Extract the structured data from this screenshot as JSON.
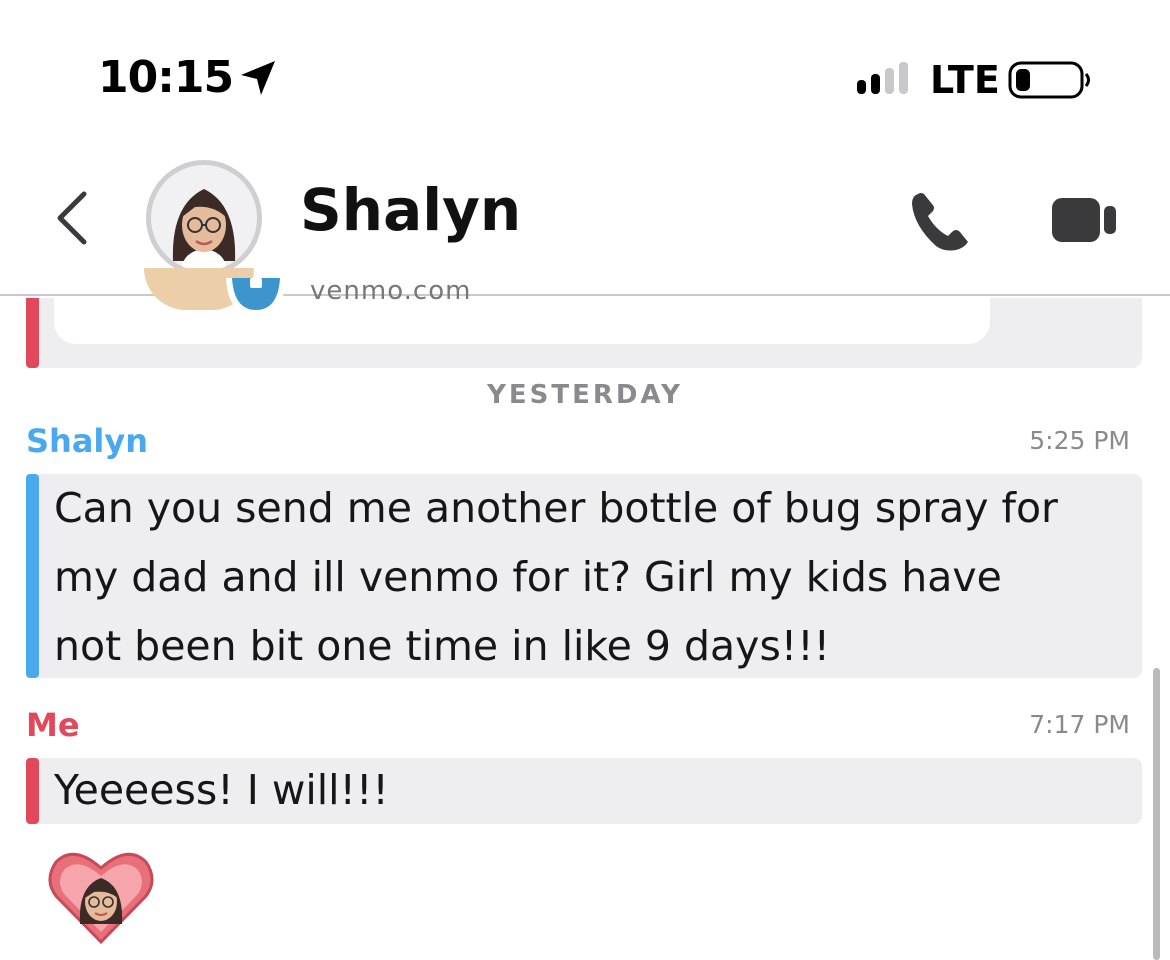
{
  "status_bar": {
    "time": "10:15",
    "network": "LTE",
    "icons": [
      "location-arrow-icon",
      "signal-icon",
      "battery-icon"
    ]
  },
  "header": {
    "contact_name": "Shalyn",
    "icons": [
      "chevron-left-icon",
      "avatar",
      "phone-icon",
      "video-camera-icon"
    ]
  },
  "previous_card": {
    "domain": "venmo.com"
  },
  "day_divider": "YESTERDAY",
  "messages": [
    {
      "sender": "Shalyn",
      "time": "5:25 PM",
      "lines": [
        "Can you send me another bottle of bug spray for",
        "my dad and ill venmo for it? Girl my kids have",
        "not been bit one time in like 9 days!!!"
      ]
    },
    {
      "sender": "Me",
      "time": "7:17 PM",
      "lines": [
        "Yeeeess! I will!!!"
      ]
    }
  ],
  "colors": {
    "them": "#4aa8ee",
    "me": "#e2485b",
    "bubble_bg": "#eeeef0",
    "header_icons": "#3a3a3c"
  }
}
